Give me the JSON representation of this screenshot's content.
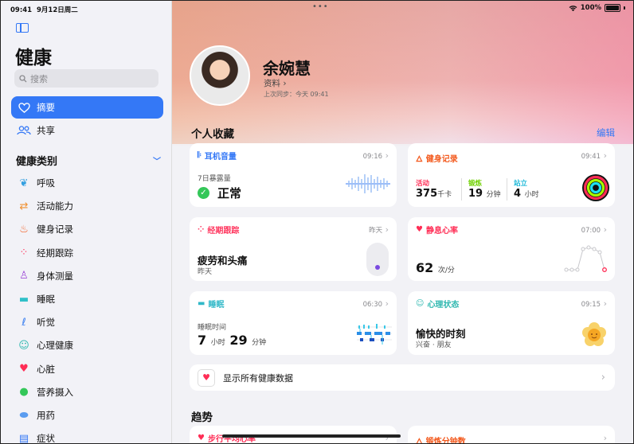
{
  "status": {
    "time": "09:41",
    "date": "9月12日周二",
    "battery": "100%"
  },
  "sidebar": {
    "title": "健康",
    "search_placeholder": "搜索",
    "summary": "摘要",
    "sharing": "共享",
    "categories_label": "健康类别",
    "items": [
      {
        "label": "呼吸",
        "icon": "lungs-icon",
        "color": "#35a0e0"
      },
      {
        "label": "活动能力",
        "icon": "arrows-icon",
        "color": "#f09030"
      },
      {
        "label": "健身记录",
        "icon": "flame-icon",
        "color": "#f35a1e"
      },
      {
        "label": "经期跟踪",
        "icon": "cycle-dots-icon",
        "color": "#ff375f"
      },
      {
        "label": "身体测量",
        "icon": "person-figure-icon",
        "color": "#a050d8"
      },
      {
        "label": "睡眠",
        "icon": "bed-icon",
        "color": "#30c0c8"
      },
      {
        "label": "听觉",
        "icon": "ear-icon",
        "color": "#3a7ff0"
      },
      {
        "label": "心理健康",
        "icon": "head-mind-icon",
        "color": "#30b8b0"
      },
      {
        "label": "心脏",
        "icon": "heart-icon",
        "color": "#ff2d55"
      },
      {
        "label": "营养摄入",
        "icon": "apple-icon",
        "color": "#34c759"
      },
      {
        "label": "用药",
        "icon": "pills-icon",
        "color": "#5a9cf0"
      },
      {
        "label": "症状",
        "icon": "clipboard-icon",
        "color": "#3478f6"
      }
    ]
  },
  "profile": {
    "name": "余婉慧",
    "link": "资料 ›",
    "sync": "上次同步：今天 09:41"
  },
  "favorites": {
    "title": "个人收藏",
    "edit": "编辑",
    "headphone": {
      "title": "耳机音量",
      "time": "09:16",
      "label": "7日暴露量",
      "value": "正常",
      "color": "#3478f6"
    },
    "fitness": {
      "title": "健身记录",
      "time": "09:41",
      "color": "#f35a1e",
      "move_label": "活动",
      "move_value": "375",
      "move_unit": "千卡",
      "exercise_label": "锻炼",
      "exercise_value": "19",
      "exercise_unit": "分钟",
      "stand_label": "站立",
      "stand_value": "4",
      "stand_unit": "小时"
    },
    "cycle": {
      "title": "经期跟踪",
      "time": "昨天",
      "value": "疲劳和头痛",
      "sub": "昨天",
      "color": "#ff375f"
    },
    "resting_hr": {
      "title": "静息心率",
      "time": "07:00",
      "value": "62",
      "unit": "次/分",
      "color": "#ff2d55"
    },
    "sleep": {
      "title": "睡眠",
      "time": "06:30",
      "label": "睡眠时间",
      "hours": "7",
      "hours_unit": "小时",
      "minutes": "29",
      "minutes_unit": "分钟",
      "color": "#30b8c8"
    },
    "mood": {
      "title": "心理状态",
      "time": "09:15",
      "value": "愉快的时刻",
      "sub": "兴奋 · 朋友",
      "color": "#30b8b0"
    }
  },
  "show_all": "显示所有健康数据",
  "trends": {
    "title": "趋势",
    "walk_hr": "步行平均心率",
    "exercise_minutes": "锻炼分钟数"
  }
}
